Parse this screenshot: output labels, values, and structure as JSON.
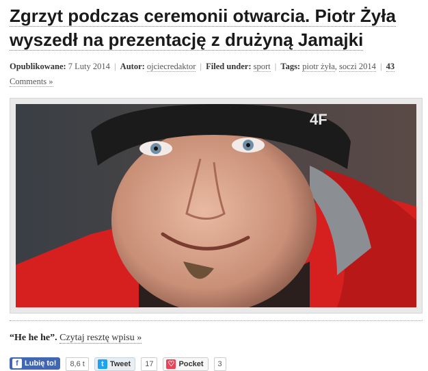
{
  "article": {
    "title_line1": "Zgrzyt podczas ceremonii otwarcia. Piotr Żyła",
    "title_line2": "wyszedł na prezentację z drużyną Jamajki"
  },
  "meta": {
    "published_label": "Opublikowane:",
    "published_date": "7 Luty 2014",
    "author_label": "Autor:",
    "author": "ojciecredaktor",
    "filed_label": "Filed under:",
    "filed": "sport",
    "tags_label": "Tags:",
    "tags": [
      "piotr żyła",
      "soczi 2014"
    ],
    "comments_count": "43",
    "comments_label": "Comments »"
  },
  "photo": {
    "icon": "portrait-photo"
  },
  "excerpt": {
    "quote": "“He he he”.",
    "read_more": "Czytaj resztę wpisu »"
  },
  "share": {
    "facebook_label": "Lubię to!",
    "facebook_count": "8,6 t",
    "twitter_label": "Tweet",
    "twitter_count": "17",
    "pocket_label": "Pocket",
    "pocket_count": "3"
  },
  "colors": {
    "facebook": "#4267b2",
    "jacket_red": "#d61f1f",
    "beanie": "#1b1b1b"
  }
}
